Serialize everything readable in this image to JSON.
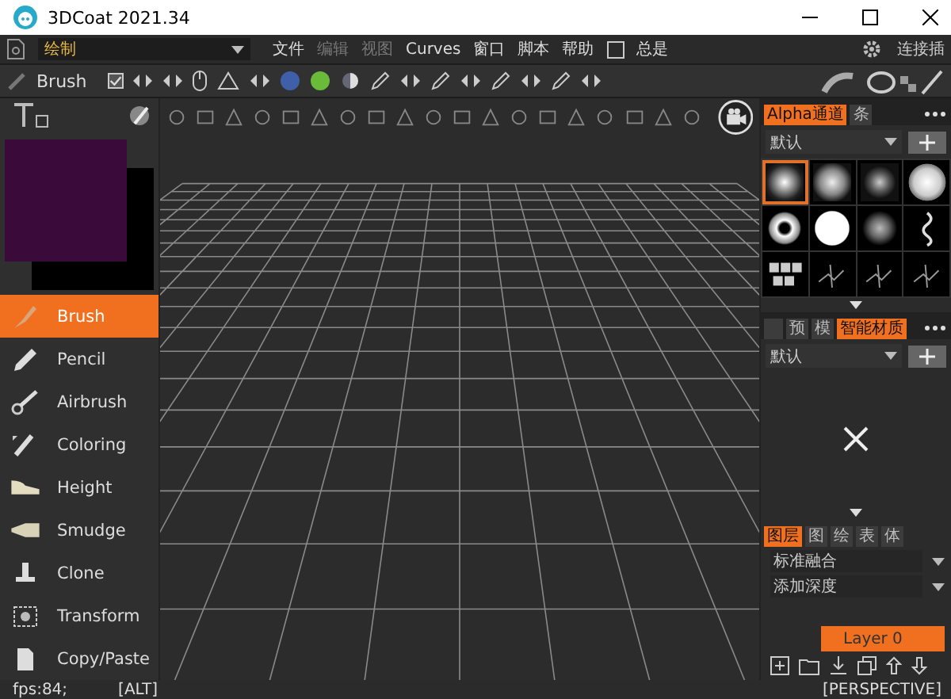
{
  "window": {
    "title": "3DCoat 2021.34"
  },
  "menu_bar": {
    "mode": "绘制",
    "items": [
      {
        "label": "文件",
        "disabled": false
      },
      {
        "label": "编辑",
        "disabled": true
      },
      {
        "label": "视图",
        "disabled": true
      },
      {
        "label": "Curves",
        "disabled": false
      },
      {
        "label": "窗口",
        "disabled": false
      },
      {
        "label": "脚本",
        "disabled": false
      },
      {
        "label": "帮助",
        "disabled": false
      }
    ],
    "always": {
      "label": "总是",
      "checked": false
    },
    "plugin_label": "连接插"
  },
  "toolbar": {
    "tool_name": "Brush",
    "checked": true
  },
  "tools": [
    {
      "label": "Brush",
      "selected": true,
      "kind": "brush"
    },
    {
      "label": "Pencil",
      "selected": false,
      "kind": "pencil"
    },
    {
      "label": "Airbrush",
      "selected": false,
      "kind": "airbrush"
    },
    {
      "label": "Coloring",
      "selected": false,
      "kind": "coloring"
    },
    {
      "label": "Height",
      "selected": false,
      "kind": "height"
    },
    {
      "label": "Smudge",
      "selected": false,
      "kind": "smudge"
    },
    {
      "label": "Clone",
      "selected": false,
      "kind": "clone"
    },
    {
      "label": "Transform",
      "selected": false,
      "kind": "transform"
    },
    {
      "label": "Copy/Paste",
      "selected": false,
      "kind": "copy"
    }
  ],
  "alpha_panel": {
    "tabs": [
      {
        "label": "Alpha通道",
        "selected": true
      },
      {
        "label": "条",
        "selected": false
      }
    ],
    "preset": "默认",
    "alphas": [
      {
        "kind": "soft",
        "selected": true
      },
      {
        "kind": "medium",
        "selected": false
      },
      {
        "kind": "hard",
        "selected": false
      },
      {
        "kind": "sphere",
        "selected": false
      },
      {
        "kind": "ring",
        "selected": false
      },
      {
        "kind": "disc",
        "selected": false
      },
      {
        "kind": "noise",
        "selected": false
      },
      {
        "kind": "squiggle",
        "selected": false
      },
      {
        "kind": "cubes",
        "selected": false
      },
      {
        "kind": "scatter",
        "selected": false
      },
      {
        "kind": "scatter",
        "selected": false
      },
      {
        "kind": "scatter",
        "selected": false
      }
    ]
  },
  "material_panel": {
    "tabs": [
      {
        "label": "预",
        "selected": false
      },
      {
        "label": "模",
        "selected": false
      },
      {
        "label": "智能材质",
        "selected": true
      }
    ],
    "preset": "默认"
  },
  "layers_panel": {
    "tabs": [
      {
        "label": "图层",
        "selected": true
      },
      {
        "label": "图",
        "selected": false
      },
      {
        "label": "绘",
        "selected": false
      },
      {
        "label": "表",
        "selected": false
      },
      {
        "label": "体",
        "selected": false
      }
    ],
    "blend_mode": "标准融合",
    "depth_mode": "添加深度",
    "layer": "Layer 0"
  },
  "status_bar": {
    "fps": "fps:84;",
    "modifier": "[ALT]",
    "projection": "[PERSPECTIVE]"
  }
}
